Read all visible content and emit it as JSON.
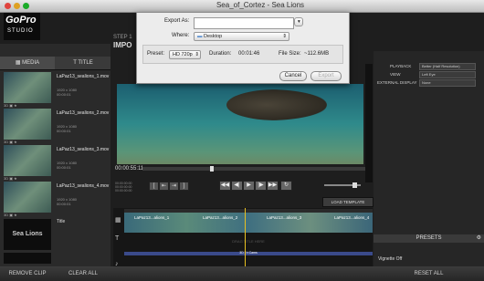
{
  "window": {
    "title": "Sea_of_Cortez - Sea Lions"
  },
  "logo": {
    "line1": "GoPro",
    "line2": "STUDIO"
  },
  "step": {
    "label": "STEP 1",
    "title": "IMPO"
  },
  "left_panel": {
    "tabs": [
      {
        "label": "MEDIA"
      },
      {
        "label": "TITLE"
      }
    ],
    "clips": [
      {
        "name": "LaPaz13_sealions_1.mov",
        "res": "1920 x 1080",
        "time": "00:00:01"
      },
      {
        "name": "LaPaz13_sealions_2.mov",
        "res": "1920 x 1080",
        "time": "00:00:01"
      },
      {
        "name": "LaPaz13_sealions_3.mov",
        "res": "1920 x 1080",
        "time": "00:00:01"
      },
      {
        "name": "LaPaz13_sealions_4.mov",
        "res": "1920 x 1080",
        "time": "00:00:01"
      }
    ],
    "title_thumb": "Sea Lions",
    "title_label": "Title"
  },
  "export_dialog": {
    "export_as_label": "Export As:",
    "export_as_value": "",
    "where_label": "Where:",
    "where_value": "Desktop",
    "preset_label": "Preset:",
    "preset_value": "HD 720p",
    "duration_label": "Duration:",
    "duration_value": "00:01:46",
    "filesize_label": "File Size:",
    "filesize_value": "~112.6MB",
    "cancel_label": "Cancel",
    "export_label": "Export"
  },
  "player": {
    "timecode": "00:00:55:11",
    "scrub_progress": 0.31,
    "volume_level": 0.85,
    "load_template_label": "LOAD TEMPLATE"
  },
  "right_panel": {
    "playback_label": "PLAYBACK",
    "playback_value": "Better (Half Resolution)",
    "view_label": "VIEW",
    "view_value": "Left Eye",
    "external_label": "EXTERNAL DISPLAY",
    "external_value": "None",
    "presets_label": "PRESETS",
    "vignette_label": "Vignette Off"
  },
  "timeline": {
    "clips": [
      {
        "label": "LaPaz13...alions_1"
      },
      {
        "label": "LaPaz13...alions_2"
      },
      {
        "label": "LaPaz13...alions_3"
      },
      {
        "label": "LaPaz13...alions_4"
      }
    ],
    "drag_title": "DRAG TITLE HERE",
    "title_bar_text": "3D Tri Cams",
    "drag_audio": "DRAG AUDIO HERE"
  },
  "bottom_bar": {
    "remove_clip": "REMOVE CLIP",
    "clear_all": "CLEAR ALL",
    "reset_all": "RESET ALL"
  },
  "colors": {
    "accent": "#e8c020",
    "title_track": "#3a4a8a"
  }
}
